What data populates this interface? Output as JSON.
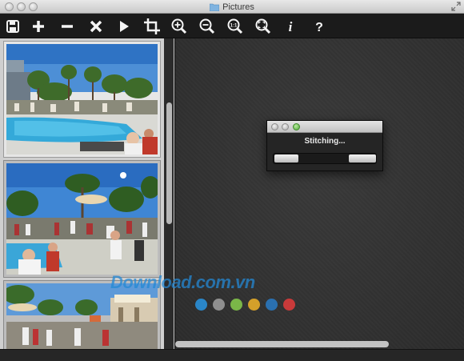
{
  "window": {
    "title": "Pictures",
    "close_icon": "close-circle-icon",
    "minimize_icon": "minimize-circle-icon",
    "zoom_icon": "zoom-circle-icon"
  },
  "toolbar": {
    "buttons": [
      {
        "name": "save-button",
        "icon": "floppy-disk-icon"
      },
      {
        "name": "add-button",
        "icon": "plus-icon"
      },
      {
        "name": "remove-button",
        "icon": "minus-icon"
      },
      {
        "name": "delete-button",
        "icon": "x-icon"
      },
      {
        "name": "play-button",
        "icon": "play-icon"
      },
      {
        "name": "crop-button",
        "icon": "crop-icon"
      },
      {
        "name": "zoom-in-button",
        "icon": "zoom-in-icon"
      },
      {
        "name": "zoom-out-button",
        "icon": "zoom-out-icon"
      },
      {
        "name": "actual-size-button",
        "icon": "zoom-1to1-icon",
        "label": "1:1"
      },
      {
        "name": "fit-button",
        "icon": "zoom-fit-icon"
      },
      {
        "name": "info-button",
        "icon": "info-icon",
        "label": "i"
      },
      {
        "name": "help-button",
        "icon": "help-icon",
        "label": "?"
      }
    ]
  },
  "sidebar": {
    "thumbnails": [
      {
        "name": "thumbnail-pool",
        "selected": true
      },
      {
        "name": "thumbnail-party",
        "selected": false
      },
      {
        "name": "thumbnail-street",
        "selected": false
      }
    ]
  },
  "dialog": {
    "message": "Stitching..."
  },
  "watermark": {
    "text": "Download.com.vn",
    "dot_colors": [
      "#2a86c8",
      "#8f8f8f",
      "#7ab648",
      "#d4a02a",
      "#2a70b0",
      "#c93a3a"
    ]
  }
}
